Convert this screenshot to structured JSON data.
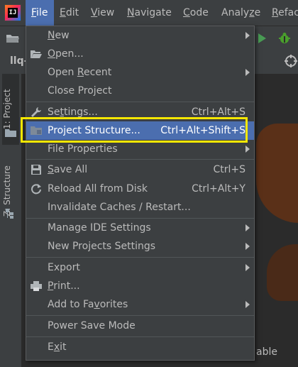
{
  "menubar": {
    "app_icon_text": "IJ",
    "items": [
      {
        "pre": "",
        "mn": "F",
        "post": "ile"
      },
      {
        "pre": "",
        "mn": "E",
        "post": "dit"
      },
      {
        "pre": "",
        "mn": "V",
        "post": "iew"
      },
      {
        "pre": "",
        "mn": "N",
        "post": "avigate"
      },
      {
        "pre": "",
        "mn": "C",
        "post": "ode"
      },
      {
        "pre": "Analy",
        "mn": "z",
        "post": "e"
      },
      {
        "pre": "",
        "mn": "R",
        "post": "efac"
      }
    ]
  },
  "crumb": {
    "text": "llq-"
  },
  "side_tabs": {
    "project": "1: Project",
    "structure": "Z: Structure"
  },
  "file_menu": {
    "items": [
      {
        "pre": "",
        "mn": "N",
        "post": "ew",
        "shortcut": "",
        "submenu": true
      },
      {
        "pre": "",
        "mn": "O",
        "post": "pen...",
        "shortcut": "",
        "submenu": false
      },
      {
        "pre": "Open ",
        "mn": "R",
        "post": "ecent",
        "shortcut": "",
        "submenu": true
      },
      {
        "pre": "Close Project",
        "mn": "",
        "post": "",
        "shortcut": "",
        "submenu": false
      },
      {
        "pre": "Se",
        "mn": "t",
        "post": "tings...",
        "shortcut": "Ctrl+Alt+S",
        "submenu": false
      },
      {
        "pre": "Project Structure...",
        "mn": "",
        "post": "",
        "shortcut": "Ctrl+Alt+Shift+S",
        "submenu": false
      },
      {
        "pre": "File Properties",
        "mn": "",
        "post": "",
        "shortcut": "",
        "submenu": true
      },
      {
        "pre": "",
        "mn": "S",
        "post": "ave All",
        "shortcut": "Ctrl+S",
        "submenu": false
      },
      {
        "pre": "Reload All from Disk",
        "mn": "",
        "post": "",
        "shortcut": "Ctrl+Alt+Y",
        "submenu": false
      },
      {
        "pre": "Invalidate Caches / Restart...",
        "mn": "",
        "post": "",
        "shortcut": "",
        "submenu": false
      },
      {
        "pre": "Manage IDE Settings",
        "mn": "",
        "post": "",
        "shortcut": "",
        "submenu": true
      },
      {
        "pre": "New Projects Settings",
        "mn": "",
        "post": "",
        "shortcut": "",
        "submenu": true
      },
      {
        "pre": "Export",
        "mn": "",
        "post": "",
        "shortcut": "",
        "submenu": true
      },
      {
        "pre": "",
        "mn": "P",
        "post": "rint...",
        "shortcut": "",
        "submenu": false
      },
      {
        "pre": "Add to Fa",
        "mn": "v",
        "post": "orites",
        "shortcut": "",
        "submenu": true
      },
      {
        "pre": "Power Save Mode",
        "mn": "",
        "post": "",
        "shortcut": "",
        "submenu": false
      },
      {
        "pre": "E",
        "mn": "x",
        "post": "it",
        "shortcut": "",
        "submenu": false
      }
    ]
  },
  "background_fragment": "able",
  "colors": {
    "accent": "#4b6eaf",
    "highlight_box": "#f5e700",
    "run": "#499c54",
    "debug": "#4a9f2c"
  }
}
